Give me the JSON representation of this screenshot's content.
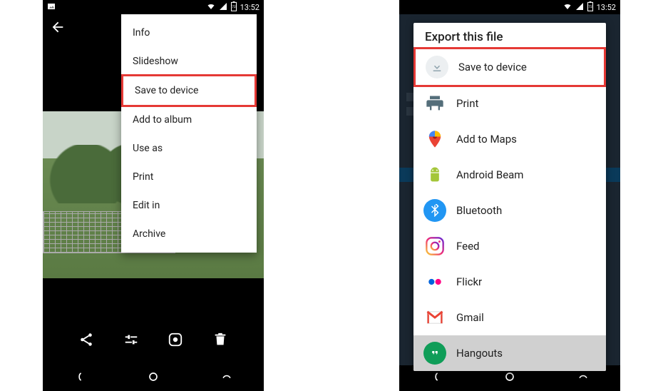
{
  "statusbar": {
    "time": "13:52",
    "battery": "72"
  },
  "left": {
    "menu": {
      "items": [
        {
          "label": "Info"
        },
        {
          "label": "Slideshow"
        },
        {
          "label": "Save to device",
          "highlighted": true
        },
        {
          "label": "Add to album"
        },
        {
          "label": "Use as"
        },
        {
          "label": "Print"
        },
        {
          "label": "Edit in"
        },
        {
          "label": "Archive"
        }
      ]
    }
  },
  "right": {
    "sheet": {
      "title": "Export this file",
      "items": [
        {
          "icon": "download-icon",
          "label": "Save to device",
          "highlighted": true
        },
        {
          "icon": "print-icon",
          "label": "Print"
        },
        {
          "icon": "maps-icon",
          "label": "Add to Maps"
        },
        {
          "icon": "android-icon",
          "label": "Android Beam"
        },
        {
          "icon": "bluetooth-icon",
          "label": "Bluetooth"
        },
        {
          "icon": "instagram-icon",
          "label": "Feed"
        },
        {
          "icon": "flickr-icon",
          "label": "Flickr"
        },
        {
          "icon": "gmail-icon",
          "label": "Gmail"
        },
        {
          "icon": "hangouts-icon",
          "label": "Hangouts"
        }
      ]
    }
  }
}
